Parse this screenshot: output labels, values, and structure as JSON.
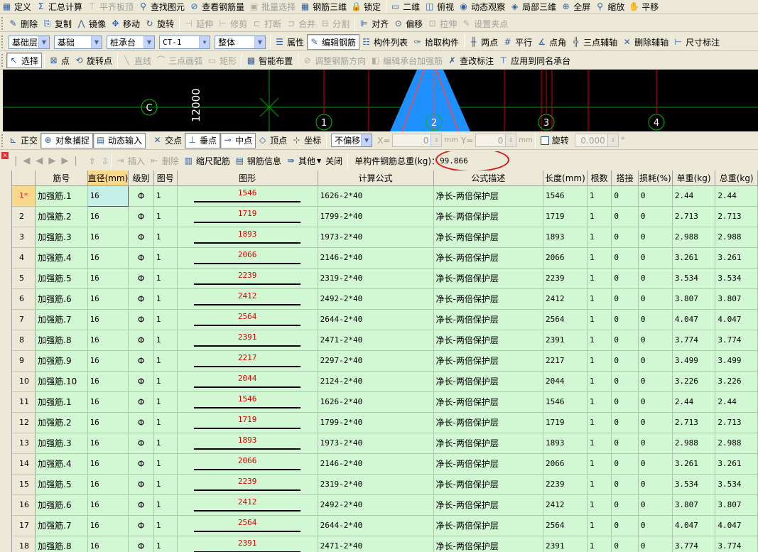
{
  "toolbar1": [
    {
      "label": "定义",
      "icon": "define-icon",
      "enabled": true
    },
    {
      "label": "汇总计算",
      "icon": "sigma-icon",
      "enabled": true
    },
    {
      "label": "平齐板顶",
      "icon": "align-top-icon",
      "enabled": false
    },
    {
      "label": "查找图元",
      "icon": "binoculars-icon",
      "enabled": true
    },
    {
      "label": "查看钢筋量",
      "icon": "view-rebar-icon",
      "enabled": true
    },
    {
      "label": "批量选择",
      "icon": "batch-select-icon",
      "enabled": false
    },
    {
      "label": "钢筋三维",
      "icon": "rebar-3d-icon",
      "enabled": true
    },
    {
      "label": "锁定",
      "icon": "lock-icon",
      "enabled": true
    },
    {
      "label": "二维",
      "icon": "2d-view-icon",
      "enabled": true
    },
    {
      "label": "俯视",
      "icon": "top-view-icon",
      "enabled": true
    },
    {
      "label": "动态观察",
      "icon": "orbit-icon",
      "enabled": true
    },
    {
      "label": "局部三维",
      "icon": "local-3d-icon",
      "enabled": true
    },
    {
      "label": "全屏",
      "icon": "fullscreen-icon",
      "enabled": true
    },
    {
      "label": "缩放",
      "icon": "zoom-icon",
      "enabled": true
    },
    {
      "label": "平移",
      "icon": "pan-icon",
      "enabled": true
    }
  ],
  "toolbar2": [
    {
      "label": "删除",
      "icon": "delete-icon",
      "enabled": true
    },
    {
      "label": "复制",
      "icon": "copy-icon",
      "enabled": true
    },
    {
      "label": "镜像",
      "icon": "mirror-icon",
      "enabled": true
    },
    {
      "label": "移动",
      "icon": "move-icon",
      "enabled": true
    },
    {
      "label": "旋转",
      "icon": "rotate-icon",
      "enabled": true
    },
    {
      "label": "延伸",
      "icon": "extend-icon",
      "enabled": false
    },
    {
      "label": "修剪",
      "icon": "trim-icon",
      "enabled": false
    },
    {
      "label": "打断",
      "icon": "break-icon",
      "enabled": false
    },
    {
      "label": "合并",
      "icon": "merge-icon",
      "enabled": false
    },
    {
      "label": "分割",
      "icon": "split-icon",
      "enabled": false
    },
    {
      "label": "对齐",
      "icon": "align-icon",
      "enabled": true
    },
    {
      "label": "偏移",
      "icon": "offset-icon",
      "enabled": true
    },
    {
      "label": "拉伸",
      "icon": "stretch-icon",
      "enabled": false
    },
    {
      "label": "设置夹点",
      "icon": "grip-point-icon",
      "enabled": false
    }
  ],
  "toolbar3": {
    "layer": "基础层",
    "category": "基础",
    "element_type": "桩承台",
    "element": "CT-1",
    "scope": "整体",
    "buttons": [
      {
        "label": "属性",
        "icon": "properties-icon"
      },
      {
        "label": "编辑钢筋",
        "icon": "edit-rebar-icon"
      },
      {
        "label": "构件列表",
        "icon": "element-list-icon"
      },
      {
        "label": "拾取构件",
        "icon": "pick-element-icon"
      },
      {
        "label": "两点",
        "icon": "two-point-icon"
      },
      {
        "label": "平行",
        "icon": "parallel-icon"
      },
      {
        "label": "点角",
        "icon": "point-angle-icon"
      },
      {
        "label": "三点辅轴",
        "icon": "three-point-axis-icon"
      },
      {
        "label": "删除辅轴",
        "icon": "delete-axis-icon"
      },
      {
        "label": "尺寸标注",
        "icon": "dimension-icon"
      }
    ]
  },
  "toolbar4": [
    {
      "label": "选择",
      "icon": "cursor-icon",
      "enabled": true
    },
    {
      "label": "点",
      "icon": "point-icon",
      "enabled": true
    },
    {
      "label": "旋转点",
      "icon": "rotate-point-icon",
      "enabled": true
    },
    {
      "label": "直线",
      "icon": "line-icon",
      "enabled": false
    },
    {
      "label": "三点画弧",
      "icon": "arc-icon",
      "enabled": false
    },
    {
      "label": "矩形",
      "icon": "rectangle-icon",
      "enabled": false
    },
    {
      "label": "智能布置",
      "icon": "smart-layout-icon",
      "enabled": true
    },
    {
      "label": "调整钢筋方向",
      "icon": "rebar-direction-icon",
      "enabled": false
    },
    {
      "label": "编辑承台加强筋",
      "icon": "edit-cap-rebar-icon",
      "enabled": false
    },
    {
      "label": "查改标注",
      "icon": "edit-label-icon",
      "enabled": true
    },
    {
      "label": "应用到同名承台",
      "icon": "apply-same-icon",
      "enabled": true
    }
  ],
  "cad": {
    "dimension": "12000",
    "axis_labels": [
      "C",
      "1",
      "2",
      "3",
      "4"
    ]
  },
  "snapbar": {
    "buttons": [
      {
        "label": "正交",
        "icon": "ortho-icon"
      },
      {
        "label": "对象捕捉",
        "icon": "snap-icon"
      },
      {
        "label": "动态输入",
        "icon": "dynamic-input-icon"
      },
      {
        "label": "交点",
        "icon": "intersection-icon"
      },
      {
        "label": "垂点",
        "icon": "perpendicular-icon"
      },
      {
        "label": "中点",
        "icon": "midpoint-icon"
      },
      {
        "label": "顶点",
        "icon": "vertex-icon"
      },
      {
        "label": "坐标",
        "icon": "coordinate-icon"
      }
    ],
    "offset_mode": "不偏移",
    "x_label": "X=",
    "x_value": "0",
    "y_label": "Y=",
    "y_value": "0",
    "unit": "mm",
    "rotate_label": "旋转",
    "rotate_value": "0.000",
    "degree": "°"
  },
  "rebar_toolbar": {
    "insert": "插入",
    "delete": "删除",
    "scale": "缩尺配筋",
    "info": "钢筋信息",
    "other": "其他",
    "close": "关闭",
    "total_label": "单构件钢筋总重(kg)：",
    "total_value": "99.866"
  },
  "columns": [
    "筋号",
    "直径(mm)",
    "级别",
    "图号",
    "图形",
    "计算公式",
    "公式描述",
    "长度(mm)",
    "根数",
    "搭接",
    "损耗(%)",
    "单重(kg)",
    "总重(kg)"
  ],
  "rows": [
    {
      "n": "1*",
      "name": "加强筋.1",
      "dia": "16",
      "grade": "Φ",
      "fig": "1",
      "shape": "1546",
      "formula": "1626-2*40",
      "desc": "净长-两倍保护层",
      "len": "1546",
      "count": "1",
      "lap": "0",
      "loss": "0",
      "unit_w": "2.44",
      "total_w": "2.44"
    },
    {
      "n": "2",
      "name": "加强筋.2",
      "dia": "16",
      "grade": "Φ",
      "fig": "1",
      "shape": "1719",
      "formula": "1799-2*40",
      "desc": "净长-两倍保护层",
      "len": "1719",
      "count": "1",
      "lap": "0",
      "loss": "0",
      "unit_w": "2.713",
      "total_w": "2.713"
    },
    {
      "n": "3",
      "name": "加强筋.3",
      "dia": "16",
      "grade": "Φ",
      "fig": "1",
      "shape": "1893",
      "formula": "1973-2*40",
      "desc": "净长-两倍保护层",
      "len": "1893",
      "count": "1",
      "lap": "0",
      "loss": "0",
      "unit_w": "2.988",
      "total_w": "2.988"
    },
    {
      "n": "4",
      "name": "加强筋.4",
      "dia": "16",
      "grade": "Φ",
      "fig": "1",
      "shape": "2066",
      "formula": "2146-2*40",
      "desc": "净长-两倍保护层",
      "len": "2066",
      "count": "1",
      "lap": "0",
      "loss": "0",
      "unit_w": "3.261",
      "total_w": "3.261"
    },
    {
      "n": "5",
      "name": "加强筋.5",
      "dia": "16",
      "grade": "Φ",
      "fig": "1",
      "shape": "2239",
      "formula": "2319-2*40",
      "desc": "净长-两倍保护层",
      "len": "2239",
      "count": "1",
      "lap": "0",
      "loss": "0",
      "unit_w": "3.534",
      "total_w": "3.534"
    },
    {
      "n": "6",
      "name": "加强筋.6",
      "dia": "16",
      "grade": "Φ",
      "fig": "1",
      "shape": "2412",
      "formula": "2492-2*40",
      "desc": "净长-两倍保护层",
      "len": "2412",
      "count": "1",
      "lap": "0",
      "loss": "0",
      "unit_w": "3.807",
      "total_w": "3.807"
    },
    {
      "n": "7",
      "name": "加强筋.7",
      "dia": "16",
      "grade": "Φ",
      "fig": "1",
      "shape": "2564",
      "formula": "2644-2*40",
      "desc": "净长-两倍保护层",
      "len": "2564",
      "count": "1",
      "lap": "0",
      "loss": "0",
      "unit_w": "4.047",
      "total_w": "4.047"
    },
    {
      "n": "8",
      "name": "加强筋.8",
      "dia": "16",
      "grade": "Φ",
      "fig": "1",
      "shape": "2391",
      "formula": "2471-2*40",
      "desc": "净长-两倍保护层",
      "len": "2391",
      "count": "1",
      "lap": "0",
      "loss": "0",
      "unit_w": "3.774",
      "total_w": "3.774"
    },
    {
      "n": "9",
      "name": "加强筋.9",
      "dia": "16",
      "grade": "Φ",
      "fig": "1",
      "shape": "2217",
      "formula": "2297-2*40",
      "desc": "净长-两倍保护层",
      "len": "2217",
      "count": "1",
      "lap": "0",
      "loss": "0",
      "unit_w": "3.499",
      "total_w": "3.499"
    },
    {
      "n": "10",
      "name": "加强筋.10",
      "dia": "16",
      "grade": "Φ",
      "fig": "1",
      "shape": "2044",
      "formula": "2124-2*40",
      "desc": "净长-两倍保护层",
      "len": "2044",
      "count": "1",
      "lap": "0",
      "loss": "0",
      "unit_w": "3.226",
      "total_w": "3.226"
    },
    {
      "n": "11",
      "name": "加强筋.1",
      "dia": "16",
      "grade": "Φ",
      "fig": "1",
      "shape": "1546",
      "formula": "1626-2*40",
      "desc": "净长-两倍保护层",
      "len": "1546",
      "count": "1",
      "lap": "0",
      "loss": "0",
      "unit_w": "2.44",
      "total_w": "2.44"
    },
    {
      "n": "12",
      "name": "加强筋.2",
      "dia": "16",
      "grade": "Φ",
      "fig": "1",
      "shape": "1719",
      "formula": "1799-2*40",
      "desc": "净长-两倍保护层",
      "len": "1719",
      "count": "1",
      "lap": "0",
      "loss": "0",
      "unit_w": "2.713",
      "total_w": "2.713"
    },
    {
      "n": "13",
      "name": "加强筋.3",
      "dia": "16",
      "grade": "Φ",
      "fig": "1",
      "shape": "1893",
      "formula": "1973-2*40",
      "desc": "净长-两倍保护层",
      "len": "1893",
      "count": "1",
      "lap": "0",
      "loss": "0",
      "unit_w": "2.988",
      "total_w": "2.988"
    },
    {
      "n": "14",
      "name": "加强筋.4",
      "dia": "16",
      "grade": "Φ",
      "fig": "1",
      "shape": "2066",
      "formula": "2146-2*40",
      "desc": "净长-两倍保护层",
      "len": "2066",
      "count": "1",
      "lap": "0",
      "loss": "0",
      "unit_w": "3.261",
      "total_w": "3.261"
    },
    {
      "n": "15",
      "name": "加强筋.5",
      "dia": "16",
      "grade": "Φ",
      "fig": "1",
      "shape": "2239",
      "formula": "2319-2*40",
      "desc": "净长-两倍保护层",
      "len": "2239",
      "count": "1",
      "lap": "0",
      "loss": "0",
      "unit_w": "3.534",
      "total_w": "3.534"
    },
    {
      "n": "16",
      "name": "加强筋.6",
      "dia": "16",
      "grade": "Φ",
      "fig": "1",
      "shape": "2412",
      "formula": "2492-2*40",
      "desc": "净长-两倍保护层",
      "len": "2412",
      "count": "1",
      "lap": "0",
      "loss": "0",
      "unit_w": "3.807",
      "total_w": "3.807"
    },
    {
      "n": "17",
      "name": "加强筋.7",
      "dia": "16",
      "grade": "Φ",
      "fig": "1",
      "shape": "2564",
      "formula": "2644-2*40",
      "desc": "净长-两倍保护层",
      "len": "2564",
      "count": "1",
      "lap": "0",
      "loss": "0",
      "unit_w": "4.047",
      "total_w": "4.047"
    },
    {
      "n": "18",
      "name": "加强筋.8",
      "dia": "16",
      "grade": "Φ",
      "fig": "1",
      "shape": "2391",
      "formula": "2471-2*40",
      "desc": "净长-两倍保护层",
      "len": "2391",
      "count": "1",
      "lap": "0",
      "loss": "0",
      "unit_w": "3.774",
      "total_w": "3.774"
    }
  ],
  "colors": {
    "grid_row": "#d1f8d3",
    "shape_value": "#e00000",
    "highlight_circle": "#e01010",
    "cad_blue": "#1e90ff",
    "cad_red": "#e00000"
  }
}
